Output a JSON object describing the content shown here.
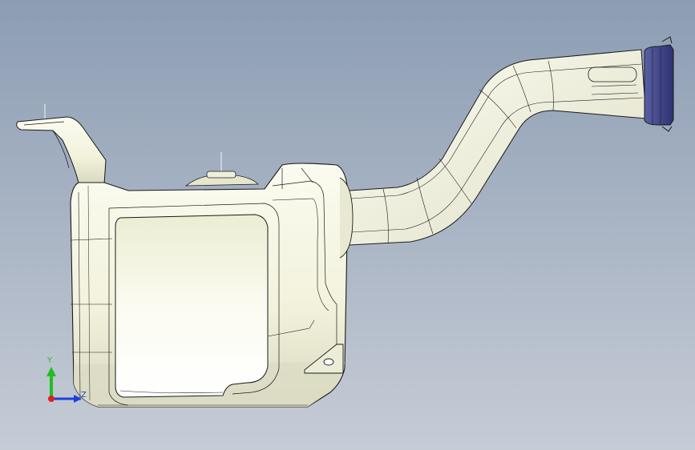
{
  "viewport": {
    "background_top": "#8c9db3",
    "background_bottom": "#c6ccd6"
  },
  "model": {
    "body_color": "#f4f4e0",
    "shade_color": "#dcdcc4",
    "edge_color": "#1a1a1a",
    "cap_color": "#4a4f8f",
    "cap_dark": "#2e3170"
  },
  "triad": {
    "y_label": "Y",
    "z_label": "Z",
    "y_color": "#1fbf1f",
    "z_color": "#1f3fdf",
    "x_color": "#df1f1f"
  }
}
